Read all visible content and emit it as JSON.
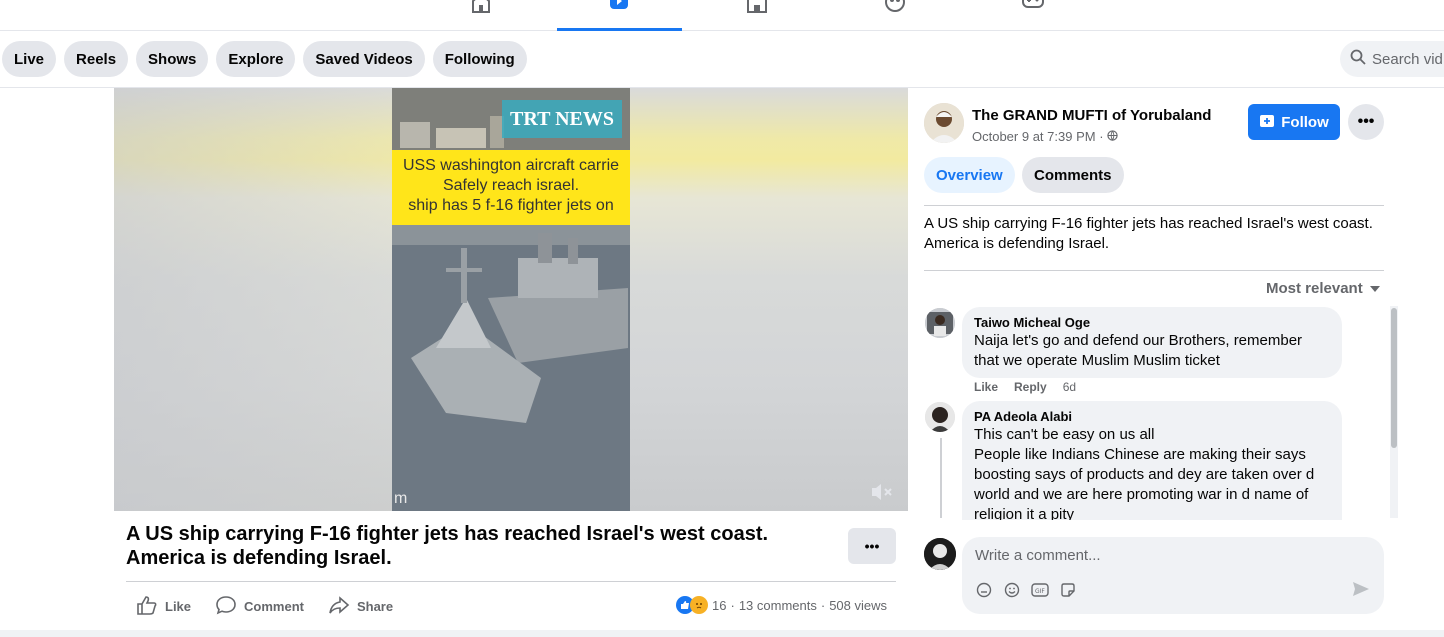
{
  "top_nav": {
    "icons": [
      "home-icon",
      "video-icon",
      "marketplace-icon",
      "groups-icon",
      "gaming-icon"
    ],
    "active": "video-icon"
  },
  "sub_nav": {
    "chips": [
      "Live",
      "Reels",
      "Shows",
      "Explore",
      "Saved Videos",
      "Following"
    ],
    "search_placeholder": "Search vid"
  },
  "video": {
    "logo_text": "TRT NEWS",
    "caption_lines": [
      "USS washington aircraft carrie",
      "Safely reach israel.",
      "ship has 5 f-16 fighter jets on"
    ],
    "watermark": "m",
    "muted": true
  },
  "post": {
    "title": "A US ship carrying F-16 fighter jets has reached Israel's west coast. America is defending Israel.",
    "actions": {
      "like": "Like",
      "comment": "Comment",
      "share": "Share"
    },
    "reaction_count": "16",
    "comments_count": "13 comments",
    "views": "508 views",
    "separator": "·"
  },
  "sidebar": {
    "page_name": "The GRAND MUFTI of Yorubaland",
    "post_time": "October 9 at 7:39 PM",
    "follow_label": "Follow",
    "tabs": [
      "Overview",
      "Comments"
    ],
    "description": "A US ship carrying F-16 fighter jets has reached Israel's west coast. America is defending Israel.",
    "sort_label": "Most relevant",
    "comments": [
      {
        "author": "Taiwo Micheal Oge",
        "text": "Naija let's go and defend our Brothers, remember that we operate Muslim Muslim ticket",
        "like": "Like",
        "reply": "Reply",
        "age": "6d"
      },
      {
        "author": "PA Adeola Alabi",
        "lines": [
          "This can't be easy on us all",
          "People like Indians Chinese are making their says boosting says of products and dey are taken over d world and we are here promoting war in d name of religion it a pity"
        ]
      }
    ],
    "composer_placeholder": "Write a comment..."
  },
  "colors": {
    "accent": "#1877f2",
    "chip_bg": "#e4e6eb",
    "caption_yellow": "#ffe51a"
  }
}
